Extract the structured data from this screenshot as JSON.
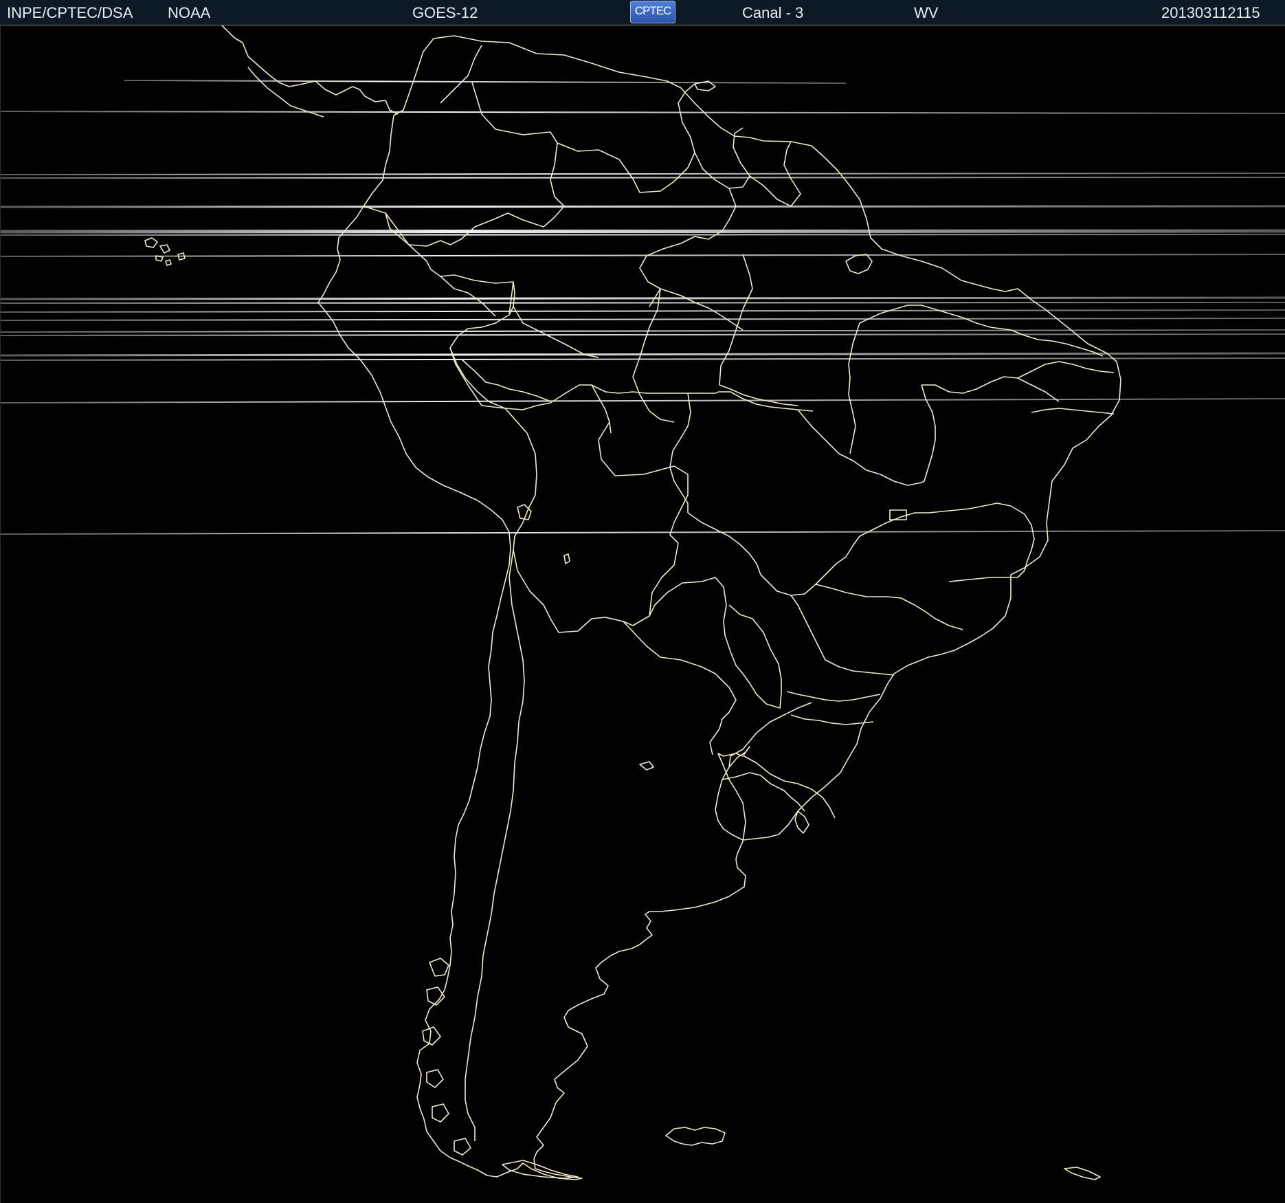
{
  "header": {
    "institution": "INPE/CPTEC/DSA",
    "agency": "NOAA",
    "satellite": "GOES-12",
    "logo_text": "CPTEC",
    "channel": "Canal - 3",
    "band": "WV",
    "timestamp": "201303112115"
  },
  "colors": {
    "background": "#000000",
    "header_background": "#0d1a26",
    "outline": "#f0ecc8",
    "scan_line": "#ffffff"
  }
}
